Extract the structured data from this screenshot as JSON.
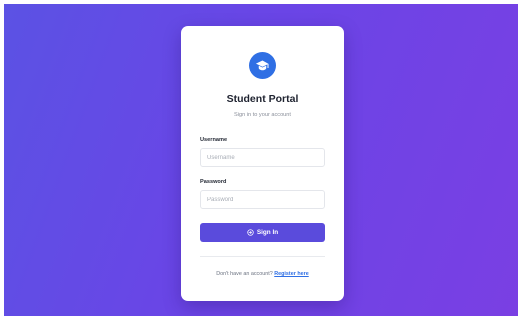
{
  "app": {
    "title": "Student Portal",
    "subtitle": "Sign in to your account",
    "logo_icon": "graduation-cap-icon"
  },
  "form": {
    "username": {
      "label": "Username",
      "placeholder": "Username",
      "value": ""
    },
    "password": {
      "label": "Password",
      "placeholder": "Password",
      "value": ""
    },
    "submit": {
      "label": "Sign In",
      "icon": "login-icon"
    }
  },
  "footer": {
    "prompt": "Don't have an account?",
    "link": "Register here"
  },
  "colors": {
    "background_start": "#5b52e4",
    "background_end": "#7a3fe3",
    "logo": "#2f6fe4",
    "button": "#5a4bdc",
    "link": "#2f6fe4"
  }
}
